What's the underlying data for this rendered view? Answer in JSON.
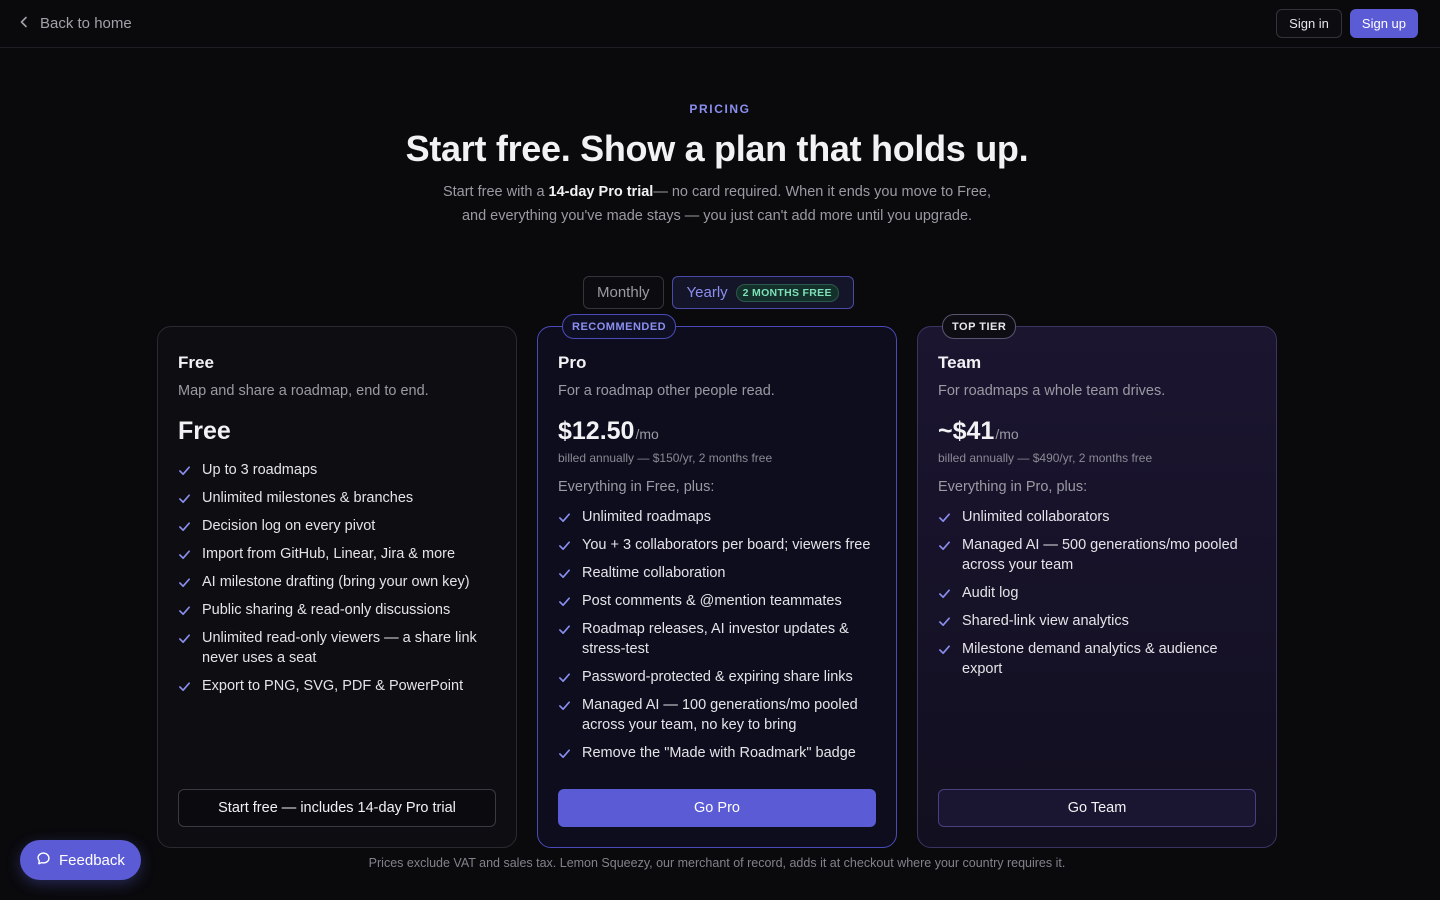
{
  "nav": {
    "back_label": "Back to home",
    "signin_label": "Sign in",
    "signup_label": "Sign up"
  },
  "hero": {
    "eyebrow": "PRICING",
    "title": "Start free. Show a plan that holds up.",
    "sub_prefix": "Start free with a ",
    "sub_bold": "14-day Pro trial",
    "sub_line1_rest": "— no card required. When it ends you move to Free,",
    "sub_line2": "and everything you've made stays — you just can't add more until you upgrade."
  },
  "billing_toggle": {
    "monthly_label": "Monthly",
    "yearly_label": "Yearly",
    "yearly_badge": "2 MONTHS FREE",
    "selected": "Yearly"
  },
  "plans": [
    {
      "name": "Free",
      "description": "Map and share a roadmap, end to end.",
      "price": "Free",
      "features": [
        "Up to 3 roadmaps",
        "Unlimited milestones & branches",
        "Decision log on every pivot",
        "Import from GitHub, Linear, Jira & more",
        "AI milestone drafting (bring your own key)",
        "Public sharing & read-only discussions",
        "Unlimited read-only viewers — a share link never uses a seat",
        "Export to PNG, SVG, PDF & PowerPoint"
      ],
      "cta": "Start free — includes 14-day Pro trial"
    },
    {
      "name": "Pro",
      "tag": "RECOMMENDED",
      "description": "For a roadmap other people read.",
      "price": "$12.50",
      "per": "/mo",
      "billed": "billed annually — $150/yr, 2 months free",
      "plus": "Everything in Free, plus:",
      "features": [
        "Unlimited roadmaps",
        "You + 3 collaborators per board; viewers free",
        "Realtime collaboration",
        "Post comments & @mention teammates",
        "Roadmap releases, AI investor updates & stress-test",
        "Password-protected & expiring share links",
        "Managed AI — 100 generations/mo pooled across your team, no key to bring",
        "Remove the \"Made with Roadmark\" badge"
      ],
      "cta": "Go Pro"
    },
    {
      "name": "Team",
      "tag": "TOP TIER",
      "description": "For roadmaps a whole team drives.",
      "price": "~$41",
      "per": "/mo",
      "billed": "billed annually — $490/yr, 2 months free",
      "plus": "Everything in Pro, plus:",
      "features": [
        "Unlimited collaborators",
        "Managed AI — 500 generations/mo pooled across your team",
        "Audit log",
        "Shared-link view analytics",
        "Milestone demand analytics & audience export"
      ],
      "cta": "Go Team"
    }
  ],
  "footnote": "Prices exclude VAT and sales tax. Lemon Squeezy, our merchant of record, adds it at checkout where your country requires it.",
  "feedback_label": "Feedback",
  "icons": {
    "back": "chevron-left-icon",
    "check": "check-icon",
    "feedback": "chat-bubble-icon"
  },
  "colors": {
    "accent": "#5b5bd6",
    "accent_text": "#8b8ff0",
    "badge_green": "#7ee0b8",
    "background": "#0a0a0d"
  }
}
